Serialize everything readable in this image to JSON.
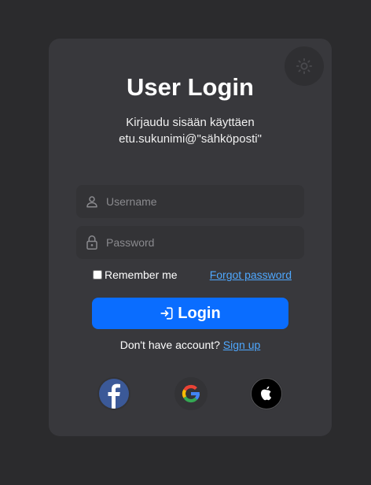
{
  "login": {
    "title": "User Login",
    "subtitle": "Kirjaudu sisään käyttäen etu.sukunimi@\"sähköposti\"",
    "username_placeholder": "Username",
    "password_placeholder": "Password",
    "remember_label": "Remember me",
    "forgot_label": "Forgot password",
    "button_label": "Login",
    "no_account_text": "Don't have account?",
    "signup_label": "Sign up"
  },
  "icons": {
    "theme_toggle": "sun-icon",
    "username": "user-icon",
    "password": "lock-icon",
    "login": "login-icon",
    "social": [
      "facebook-icon",
      "google-icon",
      "apple-icon"
    ]
  },
  "colors": {
    "background": "#2b2b2d",
    "card": "#38383c",
    "input": "#333336",
    "accent": "#0a6dff",
    "link": "#4fa8ff",
    "facebook": "#3b5998"
  }
}
